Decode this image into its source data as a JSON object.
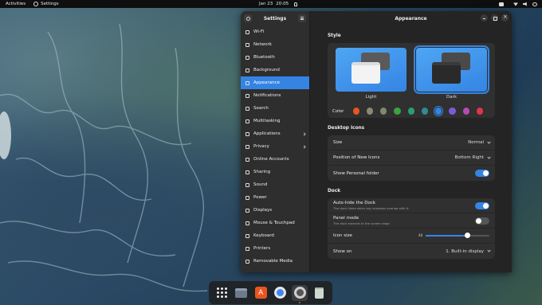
{
  "topbar": {
    "activities": "Activities",
    "app_name": "Settings",
    "date": "Jan 23",
    "time": "20:05"
  },
  "sidebar": {
    "title": "Settings",
    "items": [
      {
        "label": "Wi-Fi",
        "icon": "wifi-icon"
      },
      {
        "label": "Network",
        "icon": "network-icon"
      },
      {
        "label": "Bluetooth",
        "icon": "bluetooth-icon"
      },
      {
        "label": "Background",
        "icon": "background-icon"
      },
      {
        "label": "Appearance",
        "icon": "appearance-icon"
      },
      {
        "label": "Notifications",
        "icon": "bell-icon"
      },
      {
        "label": "Search",
        "icon": "search-icon"
      },
      {
        "label": "Multitasking",
        "icon": "multitasking-icon"
      },
      {
        "label": "Applications",
        "icon": "applications-icon"
      },
      {
        "label": "Privacy",
        "icon": "privacy-icon"
      },
      {
        "label": "Online Accounts",
        "icon": "cloud-icon"
      },
      {
        "label": "Sharing",
        "icon": "sharing-icon"
      },
      {
        "label": "Sound",
        "icon": "sound-icon"
      },
      {
        "label": "Power",
        "icon": "power-icon"
      },
      {
        "label": "Displays",
        "icon": "display-icon"
      },
      {
        "label": "Mouse & Touchpad",
        "icon": "mouse-icon"
      },
      {
        "label": "Keyboard",
        "icon": "keyboard-icon"
      },
      {
        "label": "Printers",
        "icon": "printer-icon"
      },
      {
        "label": "Removable Media",
        "icon": "media-icon"
      }
    ],
    "active_index": 4
  },
  "main": {
    "title": "Appearance",
    "style": {
      "heading": "Style",
      "light_label": "Light",
      "dark_label": "Dark",
      "selected": "Dark",
      "color_label": "Color",
      "colors": [
        "#e95420",
        "#8a8a6e",
        "#7d8b6a",
        "#3ea03e",
        "#2a9d74",
        "#308b93",
        "#3584e4",
        "#7c5bd8",
        "#b34cb2",
        "#e0344d"
      ],
      "selected_color_index": 6
    },
    "desktop_icons": {
      "heading": "Desktop Icons",
      "size_label": "Size",
      "size_value": "Normal",
      "position_label": "Position of New Icons",
      "position_value": "Bottom Right",
      "personal_label": "Show Personal folder",
      "personal_on": true
    },
    "dock": {
      "heading": "Dock",
      "autohide_label": "Auto-hide the Dock",
      "autohide_sub": "The dock hides when any windows overlap with it.",
      "autohide_on": true,
      "panel_label": "Panel mode",
      "panel_sub": "The dock extends to the screen edge.",
      "panel_on": false,
      "icon_size_label": "Icon size",
      "icon_size_value": "48",
      "icon_size_fraction": 0.65,
      "show_on_label": "Show on",
      "show_on_value": "1. Built-in display"
    }
  },
  "dock": {
    "items": [
      "show-apps",
      "files",
      "app-center",
      "chromium",
      "settings",
      "trash"
    ]
  }
}
